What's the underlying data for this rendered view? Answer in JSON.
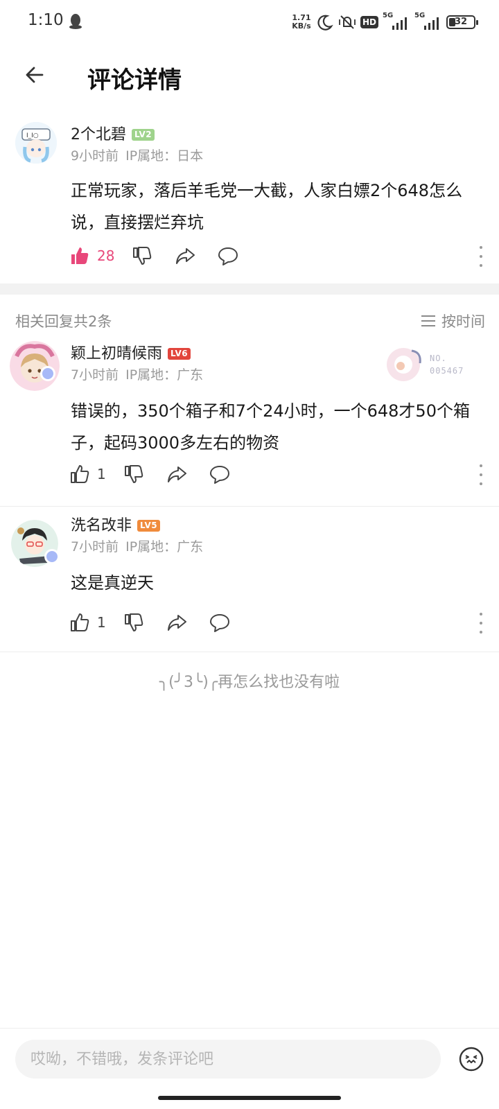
{
  "status_bar": {
    "time": "1:10",
    "net_speed_value": "1.71",
    "net_speed_unit": "KB/s",
    "hd_label": "HD",
    "net1": "5G",
    "net2": "5G",
    "battery": "32"
  },
  "header": {
    "title": "评论详情"
  },
  "main_comment": {
    "username": "2个北碧",
    "level": "LV2",
    "time_ago": "9小时前",
    "ip": "IP属地：日本",
    "text": "正常玩家，落后羊毛党一大截，人家白嫖2个648怎么说，直接摆烂弃坑",
    "likes": "28",
    "liked": true
  },
  "replies_header": {
    "count_label": "相关回复共2条",
    "sort_label": "按时间"
  },
  "replies": [
    {
      "username": "颖上初晴候雨",
      "level": "LV6",
      "time_ago": "7小时前",
      "ip": "IP属地：广东",
      "text": "错误的，350个箱子和7个24小时，一个648才50个箱子，起码3000多左右的物资",
      "likes": "1",
      "badge_no_label": "NO.",
      "badge_no_value": "005467"
    },
    {
      "username": "洗名改非",
      "level": "LV5",
      "time_ago": "7小时前",
      "ip": "IP属地：广东",
      "text": "这是真逆天",
      "likes": "1"
    }
  ],
  "end_note": "╮(╯3╰)╭再怎么找也没有啦",
  "bottom_bar": {
    "input_placeholder": "哎呦，不错哦，发条评论吧"
  },
  "colors": {
    "like_active": "#e8477a",
    "lv2": "#9fd38c",
    "lv5": "#f08b3c",
    "lv6": "#e2453c",
    "meta_gray": "#9a9a9a"
  }
}
